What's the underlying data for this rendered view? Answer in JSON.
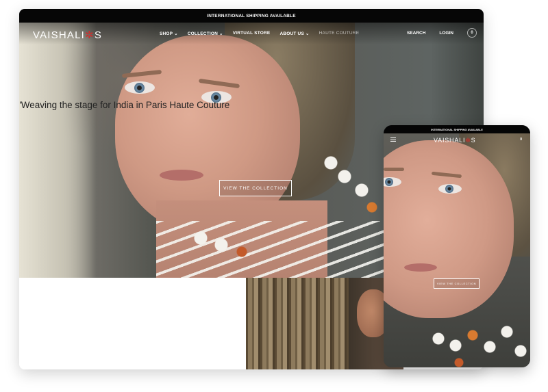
{
  "announcement": "INTERNATIONAL SHIPPING AVAILABLE",
  "brand": {
    "prefix": "VAISHALI",
    "star": "✲",
    "suffix": "S",
    "star_color": "#d62a2a"
  },
  "nav": {
    "items": [
      {
        "label": "SHOP",
        "caret": "⌄"
      },
      {
        "label": "COLLECTION",
        "caret": "⌄"
      },
      {
        "label": "VIRTUAL STORE",
        "caret": ""
      },
      {
        "label": "ABOUT US",
        "caret": "⌄"
      },
      {
        "label": "HAUTE COUTURE",
        "caret": ""
      }
    ],
    "search": "SEARCH",
    "login": "LOGIN",
    "cart_count": "0"
  },
  "hero": {
    "cta": "VIEW THE COLLECTION"
  },
  "quote": "\"Weaving the stage for India in Paris Haute Couture",
  "mobile": {
    "announcement": "INTERNATIONAL SHIPPING AVAILABLE",
    "cart_count": "0",
    "cta": "VIEW THE COLLECTION"
  },
  "icons": [
    "menu-icon",
    "cart-icon",
    "chevron-down-icon"
  ]
}
